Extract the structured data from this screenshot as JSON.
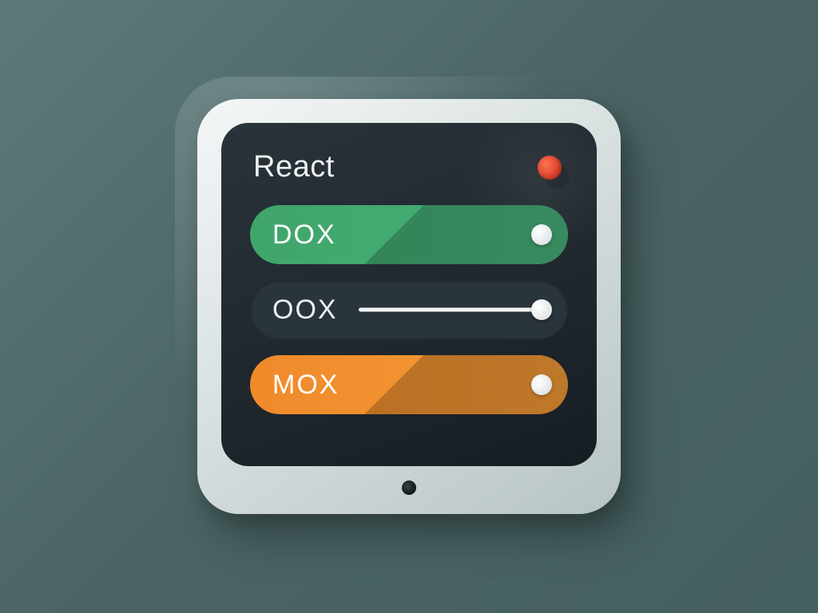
{
  "header": {
    "title": "React",
    "status_color": "#e8452a"
  },
  "options": [
    {
      "label": "DOX",
      "variant": "green",
      "knob": true,
      "color_start": "#3fa56a",
      "color_end": "#47b07a"
    },
    {
      "label": "OOX",
      "variant": "slider",
      "knob": true
    },
    {
      "label": "MOX",
      "variant": "orange",
      "knob": true,
      "color_start": "#f08a2a",
      "color_end": "#f39a36"
    }
  ]
}
